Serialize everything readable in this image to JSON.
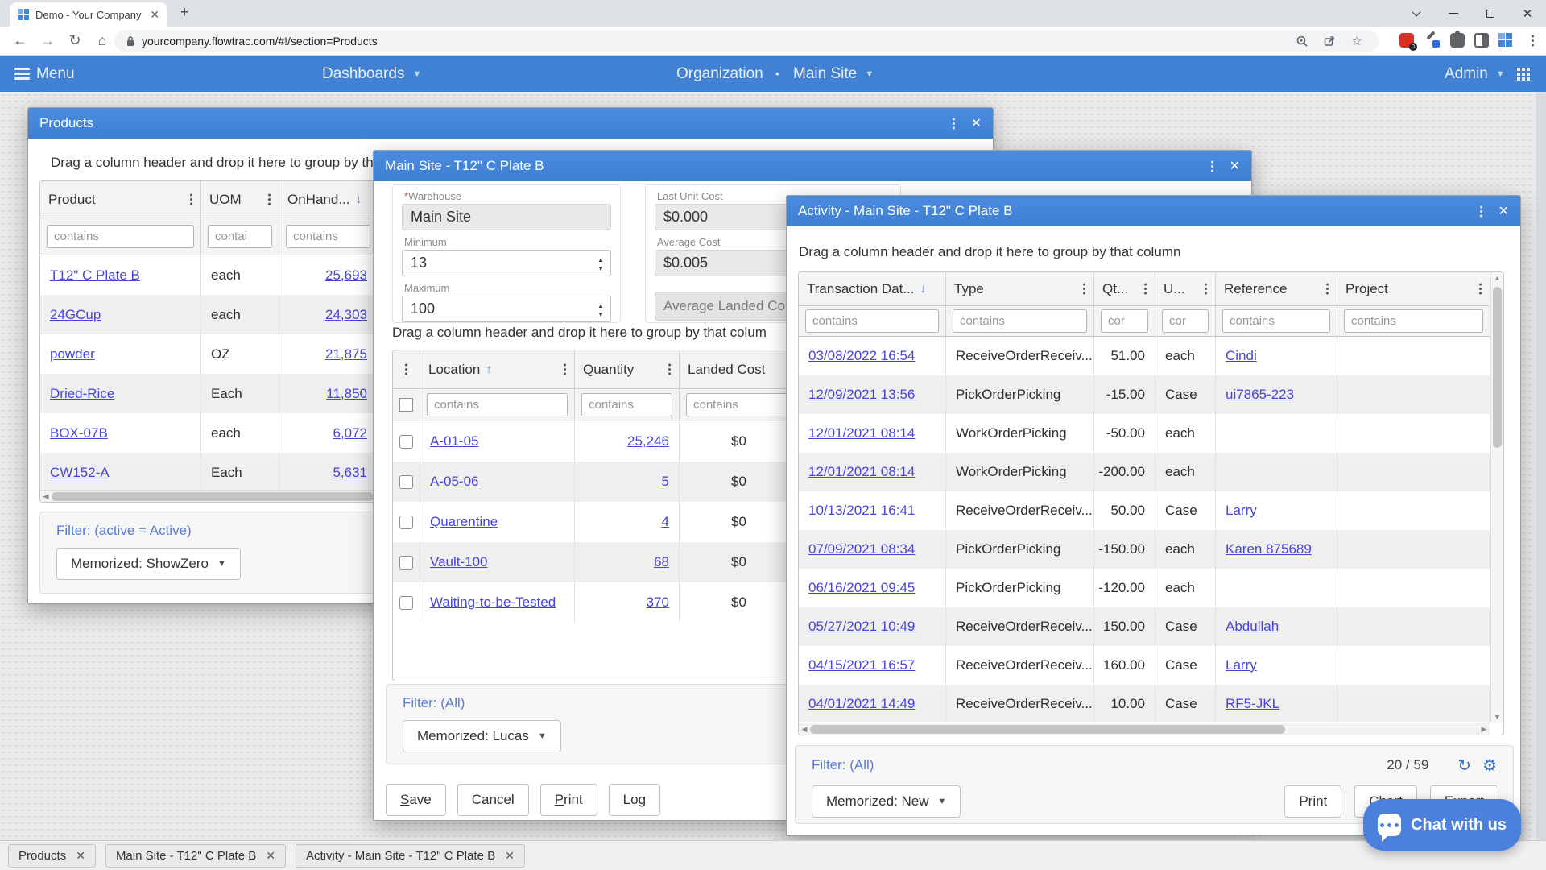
{
  "browser": {
    "tab_title": "Demo - Your Company",
    "new_tab_glyph": "+",
    "url": "yourcompany.flowtrac.com/#!/section=Products"
  },
  "navbar": {
    "menu": "Menu",
    "dashboards": "Dashboards",
    "organization": "Organization",
    "separator": "•",
    "site": "Main Site",
    "admin": "Admin"
  },
  "products": {
    "title": "Products",
    "drag_hint": "Drag a column header and drop it here to group by th",
    "columns": {
      "product": "Product",
      "uom": "UOM",
      "onhand": "OnHand..."
    },
    "filter_placeholders": {
      "product": "contains",
      "uom": "contai",
      "onhand": "contains"
    },
    "rows": [
      {
        "product": "T12\" C Plate B",
        "uom": "each",
        "onhand": "25,693"
      },
      {
        "product": "24GCup",
        "uom": "each",
        "onhand": "24,303"
      },
      {
        "product": "powder",
        "uom": "OZ",
        "onhand": "21,875"
      },
      {
        "product": "Dried-Rice",
        "uom": "Each",
        "onhand": "11,850"
      },
      {
        "product": "BOX-07B",
        "uom": "each",
        "onhand": "6,072"
      },
      {
        "product": "CW152-A",
        "uom": "Each",
        "onhand": "5,631"
      }
    ],
    "filter_label": "Filter: (active = Active)",
    "memorized_button": "Memorized: ShowZero"
  },
  "item": {
    "title": "Main Site - T12\" C Plate B",
    "required_mark": "*",
    "fields": {
      "warehouse": {
        "label": "Warehouse",
        "value": "Main Site"
      },
      "minimum": {
        "label": "Minimum",
        "value": "13"
      },
      "maximum": {
        "label": "Maximum",
        "value": "100"
      },
      "last_unit_cost": {
        "label": "Last Unit Cost",
        "value": "$0.000"
      },
      "average_cost": {
        "label": "Average Cost",
        "value": "$0.005"
      },
      "average_landed_cost_button": "Average Landed Cost"
    },
    "drag_hint": "Drag a column header and drop it here to group by that colum",
    "columns": {
      "location": "Location",
      "quantity": "Quantity",
      "landed_cost": "Landed Cost"
    },
    "filter_placeholders": {
      "location": "contains",
      "quantity": "contains",
      "landed_cost": "contains"
    },
    "rows": [
      {
        "location": "A-01-05",
        "quantity": "25,246",
        "landed_cost": "$0"
      },
      {
        "location": "A-05-06",
        "quantity": "5",
        "landed_cost": "$0"
      },
      {
        "location": "Quarentine",
        "quantity": "4",
        "landed_cost": "$0"
      },
      {
        "location": "Vault-100",
        "quantity": "68",
        "landed_cost": "$0"
      },
      {
        "location": "Waiting-to-be-Tested",
        "quantity": "370",
        "landed_cost": "$0"
      }
    ],
    "filter_label": "Filter: (All)",
    "memorized_button": "Memorized: Lucas",
    "buttons": {
      "save_accel": "S",
      "save_rest": "ave",
      "cancel": "Cancel",
      "print_accel": "P",
      "print_rest": "rint",
      "log": "Log"
    }
  },
  "activity": {
    "title": "Activity - Main Site - T12\" C Plate B",
    "drag_hint": "Drag a column header and drop it here to group by that column",
    "columns": {
      "date": "Transaction Dat...",
      "type": "Type",
      "qty": "Qt...",
      "uom": "U...",
      "reference": "Reference",
      "project": "Project"
    },
    "filter_placeholders": {
      "date": "contains",
      "type": "contains",
      "qty": "cor",
      "uom": "cor",
      "reference": "contains",
      "project": "contains"
    },
    "rows": [
      {
        "date": "03/08/2022 16:54",
        "type": "ReceiveOrderReceiv...",
        "qty": "51.00",
        "uom": "each",
        "reference": "Cindi",
        "project": ""
      },
      {
        "date": "12/09/2021 13:56",
        "type": "PickOrderPicking",
        "qty": "-15.00",
        "uom": "Case",
        "reference": "ui7865-223",
        "project": ""
      },
      {
        "date": "12/01/2021 08:14",
        "type": "WorkOrderPicking",
        "qty": "-50.00",
        "uom": "each",
        "reference": "",
        "project": ""
      },
      {
        "date": "12/01/2021 08:14",
        "type": "WorkOrderPicking",
        "qty": "-200.00",
        "uom": "each",
        "reference": "",
        "project": ""
      },
      {
        "date": "10/13/2021 16:41",
        "type": "ReceiveOrderReceiv...",
        "qty": "50.00",
        "uom": "Case",
        "reference": "Larry",
        "project": ""
      },
      {
        "date": "07/09/2021 08:34",
        "type": "PickOrderPicking",
        "qty": "-150.00",
        "uom": "each",
        "reference": "Karen 875689",
        "project": ""
      },
      {
        "date": "06/16/2021 09:45",
        "type": "PickOrderPicking",
        "qty": "-120.00",
        "uom": "each",
        "reference": "",
        "project": ""
      },
      {
        "date": "05/27/2021 10:49",
        "type": "ReceiveOrderReceiv...",
        "qty": "150.00",
        "uom": "Case",
        "reference": "Abdullah",
        "project": ""
      },
      {
        "date": "04/15/2021 16:57",
        "type": "ReceiveOrderReceiv...",
        "qty": "160.00",
        "uom": "Case",
        "reference": "Larry",
        "project": ""
      },
      {
        "date": "04/01/2021 14:49",
        "type": "ReceiveOrderReceiv...",
        "qty": "10.00",
        "uom": "Case",
        "reference": "RF5-JKL",
        "project": ""
      }
    ],
    "filter_label": "Filter: (All)",
    "count": "20 / 59",
    "memorized_button": "Memorized: New",
    "buttons": {
      "print": "Print",
      "chart": "Chart",
      "export": "Export"
    }
  },
  "taskbar": {
    "tabs": [
      "Products",
      "Main Site - T12\" C Plate B",
      "Activity - Main Site - T12\" C Plate B"
    ]
  },
  "chat": {
    "label": "Chat with us"
  }
}
